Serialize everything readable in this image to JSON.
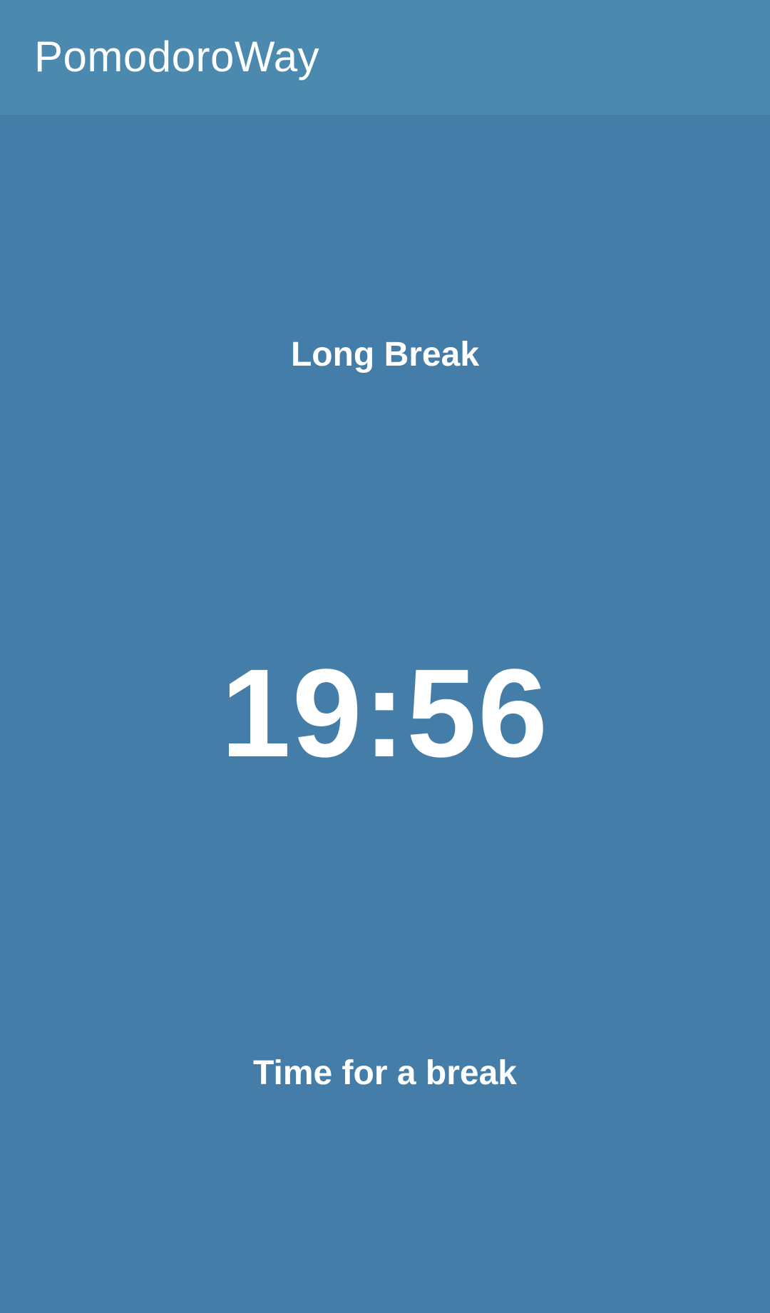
{
  "app_bar": {
    "title": "PomodoroWay"
  },
  "timer_screen": {
    "mode_label": "Long Break",
    "time_remaining": "19:56",
    "status_message": "Time for a break"
  },
  "colors": {
    "app_bar_background": "#4c89af",
    "screen_background": "#447ea8",
    "text": "#ffffff"
  }
}
